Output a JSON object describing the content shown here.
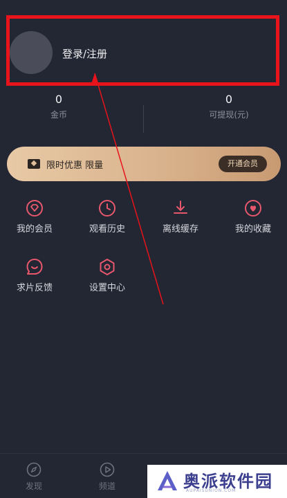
{
  "profile": {
    "login_label": "登录/注册"
  },
  "stats": {
    "coins": {
      "value": "0",
      "label": "金币"
    },
    "cash": {
      "value": "0",
      "label": "可提现(元)"
    }
  },
  "promo": {
    "text": "限时优惠 限量",
    "button": "开通会员"
  },
  "grid": {
    "items": [
      {
        "label": "我的会员",
        "icon": "diamond-icon"
      },
      {
        "label": "观看历史",
        "icon": "clock-icon"
      },
      {
        "label": "离线缓存",
        "icon": "download-icon"
      },
      {
        "label": "我的收藏",
        "icon": "heart-icon"
      },
      {
        "label": "求片反馈",
        "icon": "chat-bubble-icon"
      },
      {
        "label": "设置中心",
        "icon": "hexagon-settings-icon"
      }
    ]
  },
  "nav": {
    "items": [
      {
        "label": "发现",
        "icon": "compass-icon"
      },
      {
        "label": "频道",
        "icon": "play-icon"
      }
    ]
  },
  "watermark": {
    "text": "奥派软件园",
    "sub": "AUPAISUNION.COM"
  },
  "colors": {
    "background": "#232633",
    "accent_pink": "#e8586c",
    "highlight_red": "#e8131b",
    "promo_gold": "#e0bf9a"
  }
}
